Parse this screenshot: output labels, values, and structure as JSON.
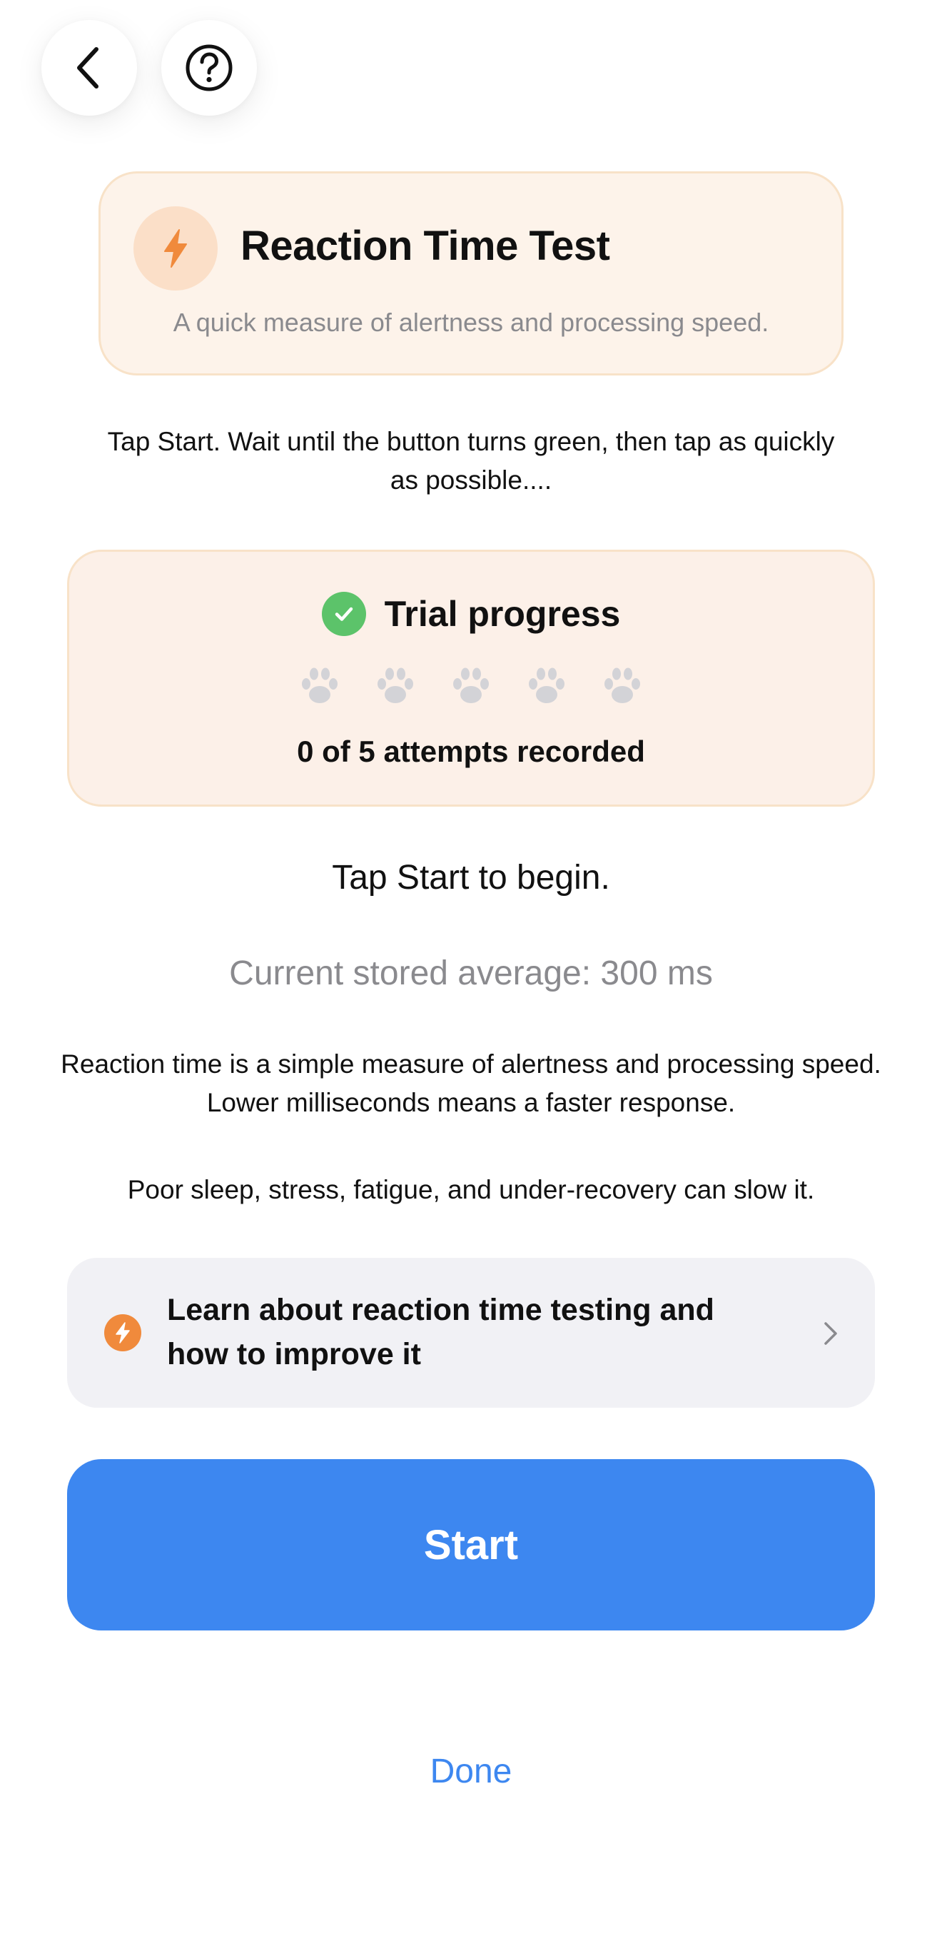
{
  "nav": {
    "back_icon": "chevron-left-icon",
    "help_icon": "question-circle-icon"
  },
  "header": {
    "icon": "lightning-bolt-icon",
    "title": "Reaction Time Test",
    "subtitle": "A quick measure of alertness and processing speed."
  },
  "instructions": "Tap Start. Wait until the button turns green, then tap as quickly as possible....",
  "trial": {
    "icon": "check-circle-icon",
    "title": "Trial progress",
    "paw_icon": "paw-icon",
    "paws_total": 5,
    "paws_completed": 0,
    "attempts_text": "0 of 5 attempts recorded"
  },
  "status": "Tap Start to begin.",
  "average": "Current stored average: 300 ms",
  "explanation": "Reaction time is a simple measure of alertness and processing speed. Lower milliseconds means a faster response.",
  "explanation2": "Poor sleep, stress, fatigue, and under-recovery can slow it.",
  "learn": {
    "icon": "lightning-bolt-icon",
    "label": "Learn about reaction time testing and how to improve it",
    "chevron_icon": "chevron-right-icon"
  },
  "start_label": "Start",
  "done_label": "Done",
  "colors": {
    "accent_blue": "#3d87f0",
    "accent_orange": "#f08a3c",
    "success_green": "#5cc36a",
    "card_peach": "#fdf3ea",
    "paw_gray": "#d3d3d7"
  }
}
